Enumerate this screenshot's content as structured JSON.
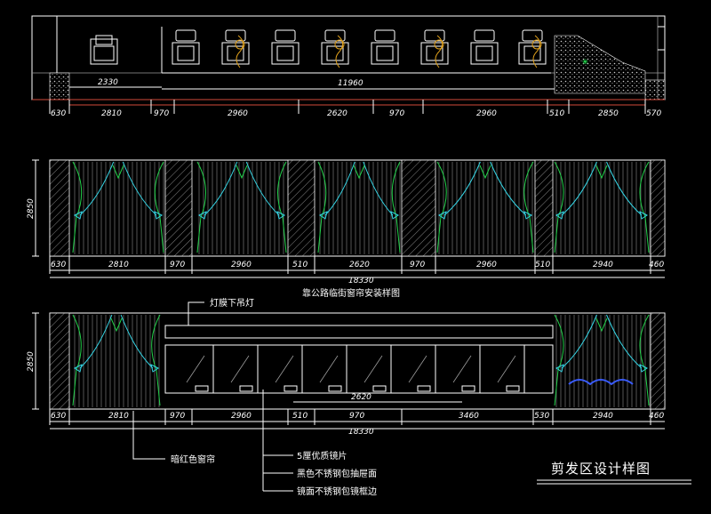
{
  "plan": {
    "dims_top": [
      "2330",
      "11960"
    ],
    "dims_bottom": [
      "630",
      "2810",
      "970",
      "2960",
      "2620",
      "970",
      "2960",
      "510",
      "2850",
      "570"
    ]
  },
  "elev1": {
    "height_dim": "2850",
    "dims": [
      "630",
      "2810",
      "970",
      "2960",
      "510",
      "2620",
      "970",
      "2960",
      "510",
      "2940",
      "460"
    ],
    "total": "18330",
    "caption": "靠公路临街窗帘安装样图"
  },
  "elev2": {
    "height_dim": "2850",
    "upper_label": "灯膜下吊灯",
    "inner_dim": "2620",
    "dims": [
      "630",
      "2810",
      "970",
      "2960",
      "510",
      "970",
      "3460",
      "530",
      "2940",
      "460"
    ],
    "total": "18330",
    "labels": {
      "curtain": "暗红色窗帘",
      "mirror": "5厘优质镜片",
      "black_steel": "黑色不锈钢包抽屉面",
      "mirror_steel": "镜面不锈钢包镜框边"
    }
  },
  "title": "剪发区设计样图",
  "colors": {
    "background": "#000000",
    "curtain_green": "#22d14a",
    "curtain_cyan": "#35d6e6",
    "chair_orange": "#e2a21c",
    "dim_red": "#d24a3a"
  }
}
